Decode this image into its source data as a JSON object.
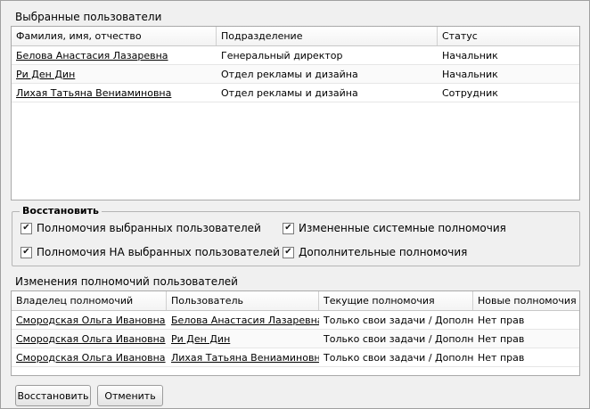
{
  "selected_users": {
    "title": "Выбранные пользователи",
    "columns": [
      "Фамилия, имя, отчество",
      "Подразделение",
      "Статус"
    ],
    "rows": [
      {
        "name": "Белова Анастасия Лазаревна",
        "department": "Генеральный директор",
        "status": "Начальник"
      },
      {
        "name": "Ри Ден Дин",
        "department": "Отдел рекламы и дизайна",
        "status": "Начальник"
      },
      {
        "name": "Лихая Татьяна Вениаминовна",
        "department": "Отдел рекламы и дизайна",
        "status": "Сотрудник"
      }
    ]
  },
  "restore_group": {
    "legend": "Восстановить",
    "options": [
      {
        "label": "Полномочия выбранных пользователей",
        "checked": true
      },
      {
        "label": "Измененные системные полномочия",
        "checked": true
      },
      {
        "label": "Полномочия НА выбранных пользователей",
        "checked": true
      },
      {
        "label": "Дополнительные полномочия",
        "checked": true
      }
    ]
  },
  "changes": {
    "title": "Изменения полномочий пользователей",
    "columns": [
      "Владелец полномочий",
      "Пользователь",
      "Текущие полномочия",
      "Новые полномочия"
    ],
    "rows": [
      {
        "owner": "Смородская Ольга Ивановна",
        "user": "Белова Анастасия Лазаревна",
        "current": "Только свои задачи / Дополн...",
        "new": "Нет прав"
      },
      {
        "owner": "Смородская Ольга Ивановна",
        "user": "Ри Ден Дин",
        "current": "Только свои задачи / Дополн...",
        "new": "Нет прав"
      },
      {
        "owner": "Смородская Ольга Ивановна",
        "user": "Лихая Татьяна Вениаминовна",
        "current": "Только свои задачи / Дополн...",
        "new": "Нет прав"
      }
    ]
  },
  "buttons": {
    "restore": "Восстановить",
    "cancel": "Отменить"
  }
}
